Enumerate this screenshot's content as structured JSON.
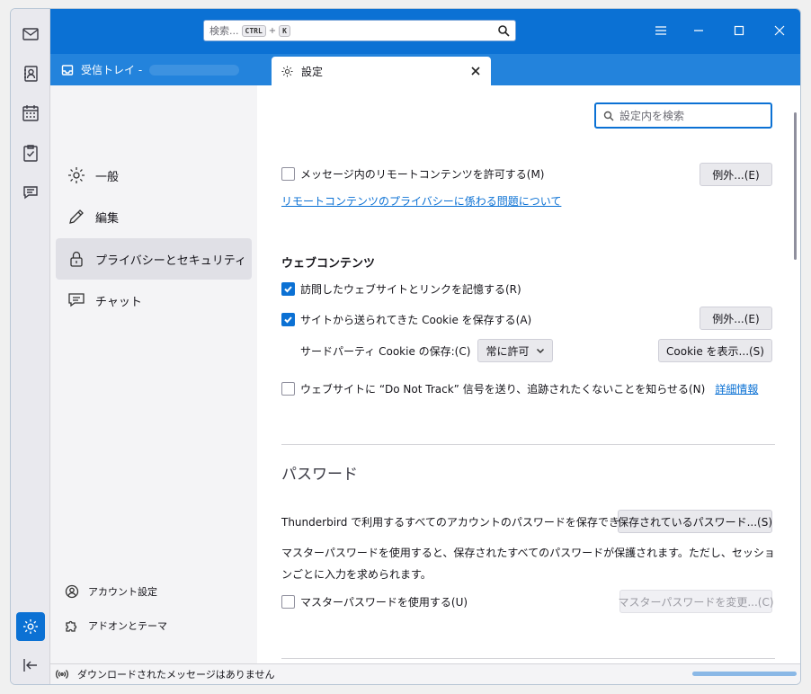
{
  "spaces": {
    "items": [
      {
        "name": "mail",
        "icon": "mail-icon"
      },
      {
        "name": "address-book",
        "icon": "address-book-icon"
      },
      {
        "name": "calendar",
        "icon": "calendar-icon"
      },
      {
        "name": "tasks",
        "icon": "tasks-icon"
      },
      {
        "name": "chat",
        "icon": "chat-icon"
      }
    ],
    "settings_icon": "gear-icon",
    "collapse_icon": "collapse-icon"
  },
  "titlebar": {
    "search_placeholder": "検索...",
    "shortcut_ctrl": "CTRL",
    "shortcut_plus": "+",
    "shortcut_k": "K"
  },
  "tabs": {
    "inbox_label": "受信トレイ -",
    "settings_label": "設定"
  },
  "categories": [
    {
      "label": "一般",
      "icon": "gear-icon"
    },
    {
      "label": "編集",
      "icon": "pencil-icon"
    },
    {
      "label": "プライバシーとセキュリティ",
      "icon": "lock-icon",
      "active": true
    },
    {
      "label": "チャット",
      "icon": "chat-icon"
    }
  ],
  "bottom_links": {
    "account_settings": "アカウント設定",
    "addons_themes": "アドオンとテーマ"
  },
  "content": {
    "find_placeholder": "設定内を検索",
    "remote_content_label": "メッセージ内のリモートコンテンツを許可する(M)",
    "remote_content_checked": false,
    "exceptions_button_1": "例外...(E)",
    "remote_privacy_link": "リモートコンテンツのプライバシーに係わる問題について",
    "web_content_heading": "ウェブコンテンツ",
    "remember_sites_label": "訪問したウェブサイトとリンクを記憶する(R)",
    "remember_sites_checked": true,
    "accept_cookies_label": "サイトから送られてきた Cookie を保存する(A)",
    "accept_cookies_checked": true,
    "exceptions_button_2": "例外...(E)",
    "third_party_label": "サードパーティ Cookie の保存:(C)",
    "third_party_value": "常に許可",
    "show_cookies_button": "Cookie を表示...(S)",
    "dnt_label": "ウェブサイトに “Do Not Track” 信号を送り、追跡されたくないことを知らせる(N)",
    "dnt_checked": false,
    "dnt_more_link": "詳細情報",
    "passwords_title": "パスワード",
    "passwords_desc": "Thunderbird で利用するすべてのアカウントのパスワードを保存できます。",
    "saved_passwords_button": "保存されているパスワード...(S)",
    "master_desc": "マスターパスワードを使用すると、保存されたすべてのパスワードが保護されます。ただし、セッションごとに入力を求められます。",
    "use_master_label": "マスターパスワードを使用する(U)",
    "use_master_checked": false,
    "change_master_button": "マスターパスワードを変更...(C)"
  },
  "statusbar": {
    "message": "ダウンロードされたメッセージはありません",
    "progress": 1.0
  }
}
